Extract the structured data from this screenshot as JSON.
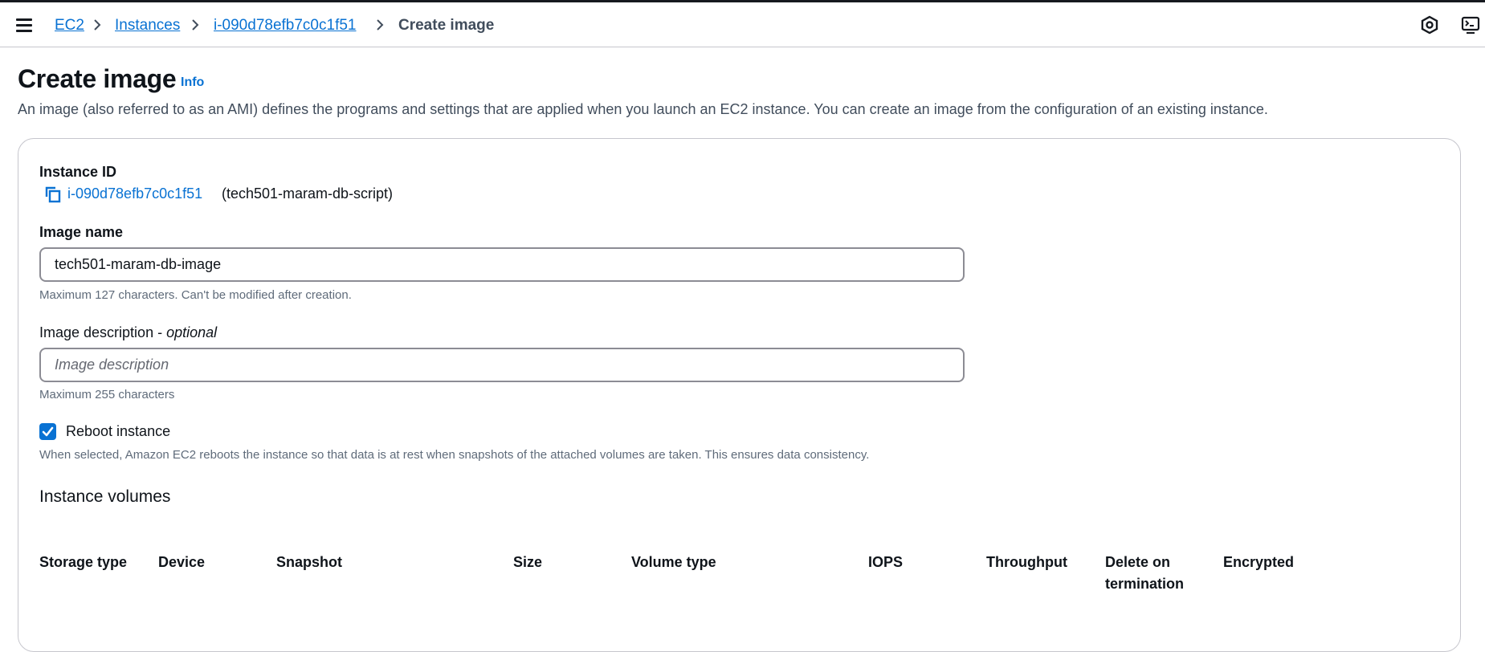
{
  "breadcrumb": {
    "items": [
      "EC2",
      "Instances",
      "i-090d78efb7c0c1f51"
    ],
    "current": "Create image"
  },
  "header": {
    "title": "Create image",
    "info": "Info",
    "description": "An image (also referred to as an AMI) defines the programs and settings that are applied when you launch an EC2 instance. You can create an image from the configuration of an existing instance."
  },
  "form": {
    "instance_id_label": "Instance ID",
    "instance_id": "i-090d78efb7c0c1f51",
    "instance_name": "(tech501-maram-db-script)",
    "image_name_label": "Image name",
    "image_name_value": "tech501-maram-db-image",
    "image_name_hint": "Maximum 127 characters. Can't be modified after creation.",
    "image_desc_label": "Image description - ",
    "image_desc_optional": "optional",
    "image_desc_placeholder": "Image description",
    "image_desc_hint": "Maximum 255 characters",
    "reboot_label": "Reboot instance",
    "reboot_checked": true,
    "reboot_hint": "When selected, Amazon EC2 reboots the instance so that data is at rest when snapshots of the attached volumes are taken. This ensures data consistency."
  },
  "volumes": {
    "title": "Instance volumes",
    "columns": [
      "Storage type",
      "Device",
      "Snapshot",
      "Size",
      "Volume type",
      "IOPS",
      "Throughput",
      "Delete on termination",
      "Encrypted"
    ]
  },
  "colors": {
    "link": "#0972d3",
    "text": "#0f141a",
    "muted": "#5f6b7a",
    "border": "#8c8c94"
  },
  "icons": [
    "menu-icon",
    "chevron-right-icon",
    "settings-hexagon-icon",
    "cloudshell-icon",
    "copy-icon",
    "checkmark-icon"
  ]
}
